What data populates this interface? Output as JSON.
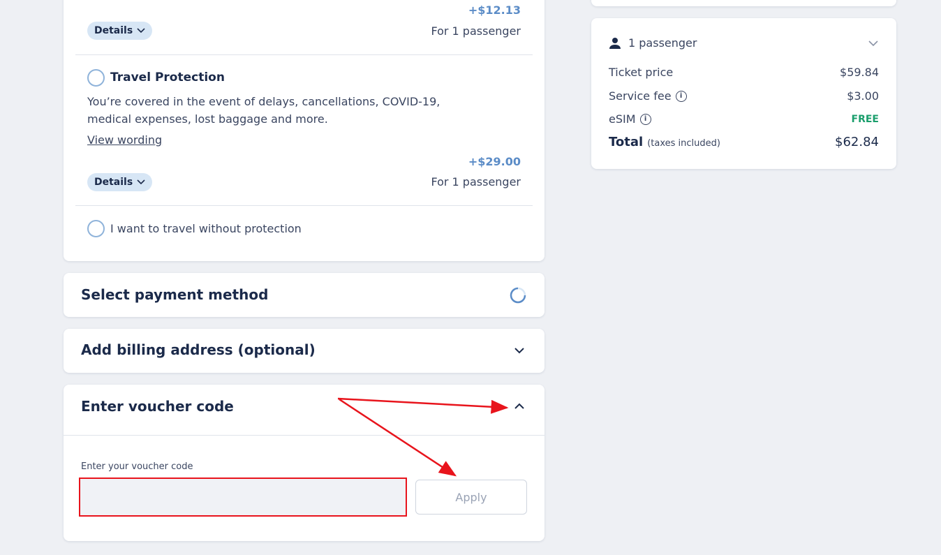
{
  "protection_card": {
    "option1": {
      "price": "+$12.13",
      "details_label": "Details",
      "per_passenger": "For 1 passenger"
    },
    "option2": {
      "title": "Travel Protection",
      "description_line1": "You’re covered in the event of delays, cancellations, COVID-19,",
      "description_line2": "medical expenses, lost baggage and more.",
      "view_wording": "View wording",
      "price": "+$29.00",
      "details_label": "Details",
      "per_passenger": "For 1 passenger"
    },
    "no_protection_label": "I want to travel without protection"
  },
  "payment": {
    "title": "Select payment method"
  },
  "billing": {
    "title": "Add billing address (optional)"
  },
  "voucher": {
    "title": "Enter voucher code",
    "field_label": "Enter your voucher code",
    "input_value": "",
    "apply_label": "Apply"
  },
  "summary": {
    "passengers": "1 passenger",
    "rows": [
      {
        "label": "Ticket price",
        "value": "$59.84"
      },
      {
        "label": "Service fee",
        "value": "$3.00"
      },
      {
        "label": "eSIM",
        "value": "FREE"
      }
    ],
    "total_label": "Total",
    "total_note": "(taxes included)",
    "total_value": "$62.84"
  },
  "colors": {
    "accent_blue": "#5b8cc7",
    "free_green": "#1a9e6c",
    "annotation_red": "#e8141c"
  }
}
